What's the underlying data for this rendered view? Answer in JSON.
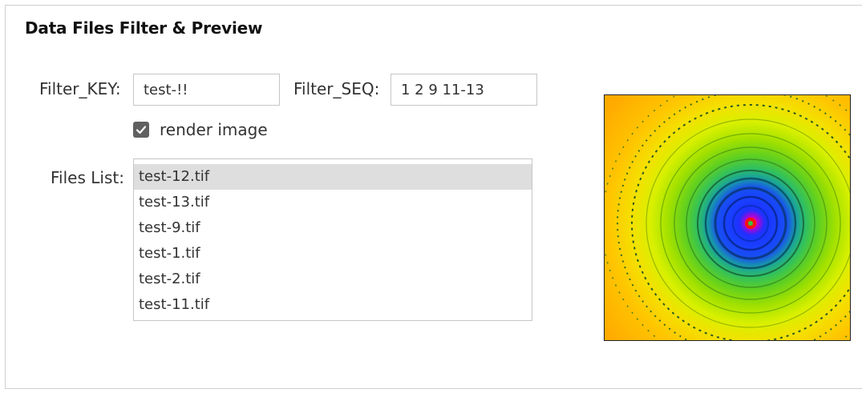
{
  "panel": {
    "title": "Data Files Filter & Preview"
  },
  "filter_key": {
    "label": "Filter_KEY:",
    "value": "test-!!"
  },
  "filter_seq": {
    "label": "Filter_SEQ:",
    "value": "1 2 9 11-13"
  },
  "render_image": {
    "label": "render image",
    "checked": true
  },
  "files_list": {
    "label": "Files List:",
    "items": [
      {
        "name": "test-12.tif",
        "selected": true
      },
      {
        "name": "test-13.tif",
        "selected": false
      },
      {
        "name": "test-9.tif",
        "selected": false
      },
      {
        "name": "test-1.tif",
        "selected": false
      },
      {
        "name": "test-2.tif",
        "selected": false
      },
      {
        "name": "test-11.tif",
        "selected": false
      }
    ]
  },
  "preview": {
    "icon": "diffraction-rings-image",
    "colors": [
      "#ff1a00",
      "#2030ff",
      "#30c060",
      "#f4e000",
      "#ffaa00"
    ]
  }
}
